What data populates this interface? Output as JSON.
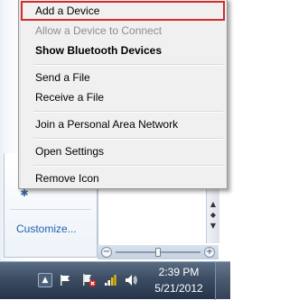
{
  "context_menu": {
    "items": [
      {
        "label": "Add a Device",
        "state": "highlighted"
      },
      {
        "label": "Allow a Device to Connect",
        "state": "disabled"
      },
      {
        "label": "Show Bluetooth Devices",
        "state": "default"
      },
      {
        "label": "Send a File",
        "state": "normal"
      },
      {
        "label": "Receive a File",
        "state": "normal"
      },
      {
        "label": "Join a Personal Area Network",
        "state": "normal"
      },
      {
        "label": "Open Settings",
        "state": "normal"
      },
      {
        "label": "Remove Icon",
        "state": "normal"
      }
    ],
    "highlight_color": "#d42b2b"
  },
  "tray_flyout": {
    "customize_label": "Customize..."
  },
  "taskbar": {
    "clock_time": "2:39 PM",
    "clock_date": "5/21/2012",
    "icons": [
      "show-hidden-icons-arrow",
      "flag-icon",
      "network-error-icon",
      "signal-icon",
      "volume-icon"
    ]
  }
}
